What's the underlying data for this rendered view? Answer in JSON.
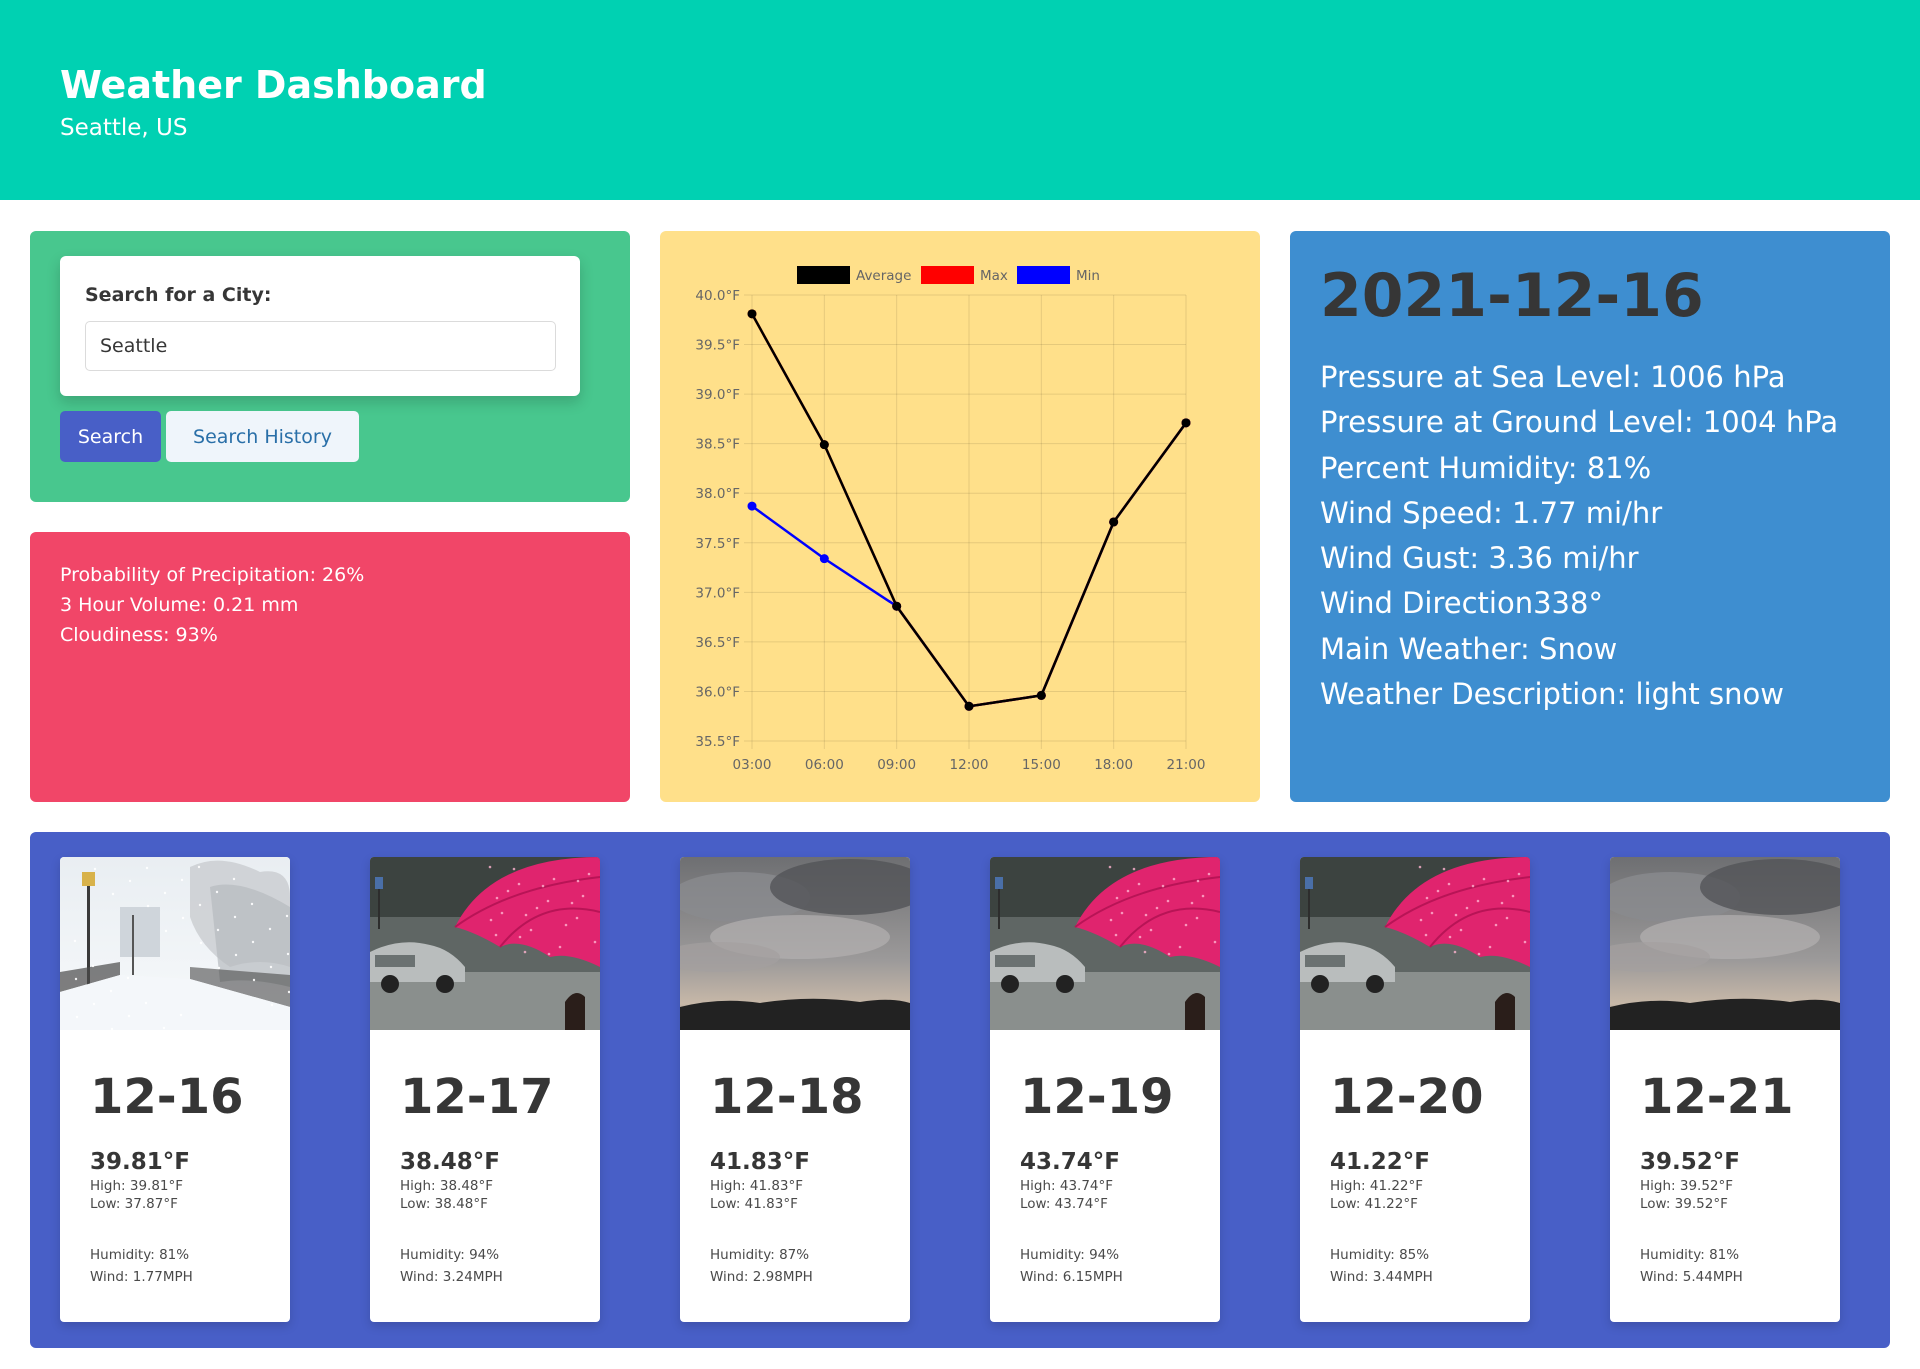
{
  "header": {
    "title": "Weather Dashboard",
    "subtitle": "Seattle, US"
  },
  "search": {
    "label": "Search for a City:",
    "value": "Seattle",
    "search_button": "Search",
    "history_button": "Search History"
  },
  "precipitation": {
    "probability": "Probability of Precipitation: 26%",
    "volume": "3 Hour Volume: 0.21 mm",
    "cloudiness": "Cloudiness: 93%"
  },
  "today": {
    "date": "2021-12-16",
    "stats": [
      "Pressure at Sea Level: 1006 hPa",
      "Pressure at Ground Level: 1004 hPa",
      "Percent Humidity: 81%",
      "Wind Speed: 1.77 mi/hr",
      "Wind Gust: 3.36 mi/hr",
      "Wind Direction338°",
      "Main Weather: Snow",
      "Weather Description: light snow"
    ]
  },
  "chart_data": {
    "type": "line",
    "title": "",
    "xlabel": "",
    "ylabel": "",
    "x": [
      "03:00",
      "06:00",
      "09:00",
      "12:00",
      "15:00",
      "18:00",
      "21:00"
    ],
    "ylim": [
      35.5,
      40.0
    ],
    "y_ticks": [
      "40.0°F",
      "39.5°F",
      "39.0°F",
      "38.5°F",
      "38.0°F",
      "37.5°F",
      "37.0°F",
      "36.5°F",
      "36.0°F",
      "35.5°F"
    ],
    "grid": true,
    "legend_position": "top",
    "series": [
      {
        "name": "Average",
        "color": "#000000",
        "values": [
          39.81,
          38.49,
          36.86,
          35.85,
          35.96,
          37.71,
          38.71
        ]
      },
      {
        "name": "Max",
        "color": "#ff0000",
        "values": [
          39.81,
          38.49,
          36.86,
          35.85,
          35.96,
          37.71,
          38.71
        ]
      },
      {
        "name": "Min",
        "color": "#0000ff",
        "values": [
          37.87,
          37.34,
          36.86,
          35.85,
          35.96,
          37.71,
          38.71
        ]
      }
    ]
  },
  "forecast": [
    {
      "date": "12-16",
      "temp": "39.81°F",
      "high": "High: 39.81°F",
      "low": "Low: 37.87°F",
      "humidity": "Humidity: 81%",
      "wind": "Wind: 1.77MPH",
      "image": "snow-street"
    },
    {
      "date": "12-17",
      "temp": "38.48°F",
      "high": "High: 38.48°F",
      "low": "Low: 38.48°F",
      "humidity": "Humidity: 94%",
      "wind": "Wind: 3.24MPH",
      "image": "rain-umbrella"
    },
    {
      "date": "12-18",
      "temp": "41.83°F",
      "high": "High: 41.83°F",
      "low": "Low: 41.83°F",
      "humidity": "Humidity: 87%",
      "wind": "Wind: 2.98MPH",
      "image": "cloudy-sky"
    },
    {
      "date": "12-19",
      "temp": "43.74°F",
      "high": "High: 43.74°F",
      "low": "Low: 43.74°F",
      "humidity": "Humidity: 94%",
      "wind": "Wind: 6.15MPH",
      "image": "rain-umbrella"
    },
    {
      "date": "12-20",
      "temp": "41.22°F",
      "high": "High: 41.22°F",
      "low": "Low: 41.22°F",
      "humidity": "Humidity: 85%",
      "wind": "Wind: 3.44MPH",
      "image": "rain-umbrella"
    },
    {
      "date": "12-21",
      "temp": "39.52°F",
      "high": "High: 39.52°F",
      "low": "Low: 39.52°F",
      "humidity": "Humidity: 81%",
      "wind": "Wind: 5.44MPH",
      "image": "cloudy-sky"
    }
  ]
}
